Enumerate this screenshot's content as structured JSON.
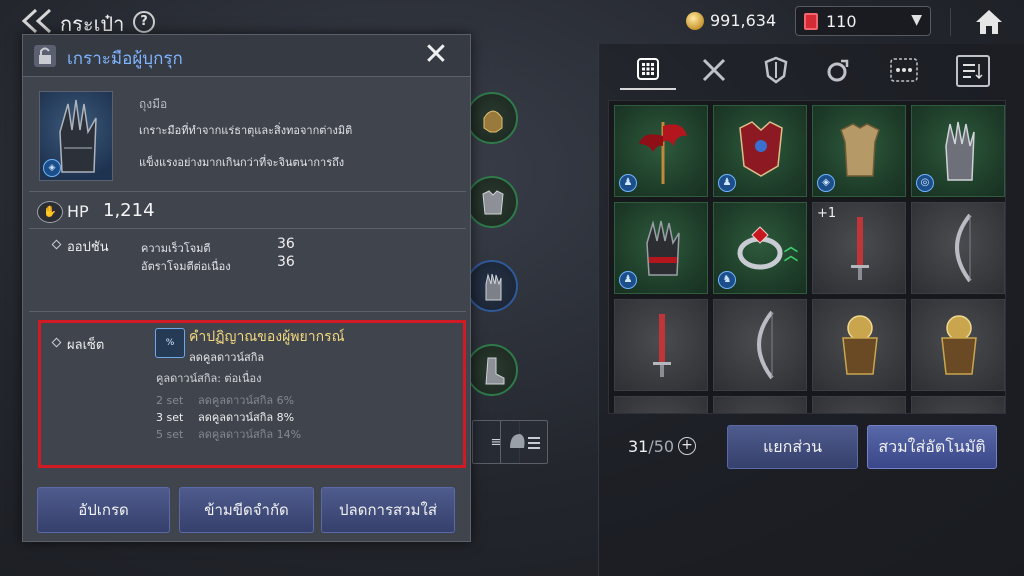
{
  "header": {
    "title": "กระเป๋า",
    "help": "?",
    "gold": "991,634",
    "gems": "110"
  },
  "inventory": {
    "count": "31",
    "capacity": "/50",
    "add": "+",
    "slot_plus": "+1",
    "dismantle_label": "แยกส่วน",
    "auto_equip_label": "สวมใส่อัตโนมัติ"
  },
  "item": {
    "name": "เกราะมือผู้บุกรุก",
    "type": "ถุงมือ",
    "desc_line1": "เกราะมือที่ทำจากแร่ธาตุและสิ่งทอจากต่างมิติ",
    "desc_line2": "แข็งแรงอย่างมากเกินกว่าที่จะจินตนาการถึง",
    "hp_label": "HP",
    "hp_value": "1,214",
    "options_label": "ออปชัน",
    "options": [
      {
        "stat": "ความเร็วโจมตี",
        "value": "36"
      },
      {
        "stat": "อัตราโจมตีต่อเนื่อง",
        "value": "36"
      }
    ],
    "set_label": "ผลเซ็ต",
    "set_name": "คำปฏิญาณของผู้พยากรณ์",
    "set_effect": "ลดคูลดาวน์สกิล",
    "set_condition": "คูลดาวน์สกิล: ต่อเนื่อง",
    "set_tiers": [
      {
        "count": "2 set",
        "effect": "ลดคูลดาวน์สกิล 6%",
        "active": false
      },
      {
        "count": "3 set",
        "effect": "ลดคูลดาวน์สกิล 8%",
        "active": true
      },
      {
        "count": "5 set",
        "effect": "ลดคูลดาวน์สกิล 14%",
        "active": false
      }
    ]
  },
  "actions": {
    "upgrade": "อัปเกรด",
    "limit_break": "ข้ามขีดจำกัด",
    "unequip": "ปลดการสวมใส่"
  },
  "colors": {
    "accent_blue": "#7fb4ff",
    "set_gold": "#f3d97e",
    "highlight_red": "#d11a23",
    "button": "#4e5b8d"
  }
}
